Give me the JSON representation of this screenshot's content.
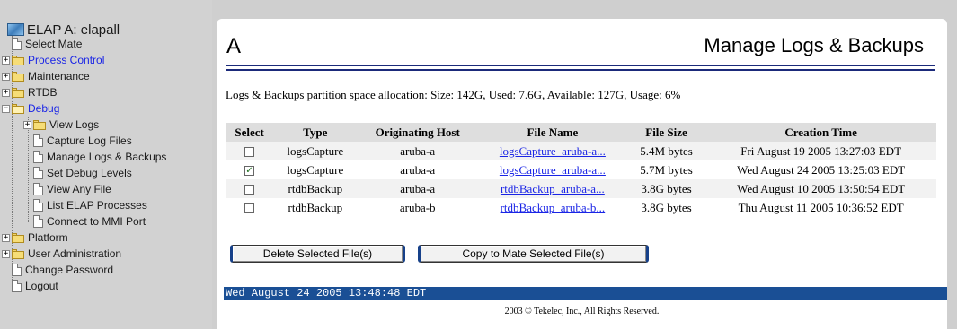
{
  "tree": {
    "root_label": "ELAP A: elapall",
    "items": [
      {
        "label": "Select Mate",
        "kind": "page",
        "level": 0
      },
      {
        "label": "Process Control",
        "kind": "folder",
        "level": 0,
        "link": true,
        "expander": "+"
      },
      {
        "label": "Maintenance",
        "kind": "folder",
        "level": 0,
        "expander": "+"
      },
      {
        "label": "RTDB",
        "kind": "folder",
        "level": 0,
        "expander": "+"
      },
      {
        "label": "Debug",
        "kind": "folder-open",
        "level": 0,
        "link": true,
        "expander": "−"
      },
      {
        "label": "View Logs",
        "kind": "folder",
        "level": 1,
        "expander": "+"
      },
      {
        "label": "Capture Log Files",
        "kind": "page",
        "level": 1
      },
      {
        "label": "Manage Logs & Backups",
        "kind": "page",
        "level": 1
      },
      {
        "label": "Set Debug Levels",
        "kind": "page",
        "level": 1
      },
      {
        "label": "View Any File",
        "kind": "page",
        "level": 1
      },
      {
        "label": "List ELAP Processes",
        "kind": "page",
        "level": 1
      },
      {
        "label": "Connect to MMI Port",
        "kind": "page",
        "level": 1
      },
      {
        "label": "Platform",
        "kind": "folder",
        "level": 0,
        "expander": "+"
      },
      {
        "label": "User Administration",
        "kind": "folder",
        "level": 0,
        "expander": "+"
      },
      {
        "label": "Change Password",
        "kind": "page",
        "level": 0
      },
      {
        "label": "Logout",
        "kind": "page",
        "level": 0
      }
    ]
  },
  "main": {
    "title_left": "A",
    "title": "Manage Logs & Backups",
    "partition_info": "Logs & Backups partition space allocation: Size: 142G, Used: 7.6G, Available: 127G, Usage: 6%",
    "table": {
      "headers": [
        "Select",
        "Type",
        "Originating Host",
        "File Name",
        "File Size",
        "Creation Time"
      ],
      "rows": [
        {
          "checked": false,
          "type": "logsCapture",
          "host": "aruba-a",
          "file": "logsCapture_aruba-a...",
          "size": "5.4M bytes",
          "time": "Fri August 19 2005 13:27:03 EDT"
        },
        {
          "checked": true,
          "type": "logsCapture",
          "host": "aruba-a",
          "file": "logsCapture_aruba-a...",
          "size": "5.7M bytes",
          "time": "Wed August 24 2005 13:25:03 EDT"
        },
        {
          "checked": false,
          "type": "rtdbBackup",
          "host": "aruba-a",
          "file": "rtdbBackup_aruba-a...",
          "size": "3.8G bytes",
          "time": "Wed August 10 2005 13:50:54 EDT"
        },
        {
          "checked": false,
          "type": "rtdbBackup",
          "host": "aruba-b",
          "file": "rtdbBackup_aruba-b...",
          "size": "3.8G bytes",
          "time": "Thu August 11 2005 10:36:52 EDT"
        }
      ]
    },
    "buttons": {
      "delete": "Delete Selected File(s)",
      "copy": "Copy to Mate Selected File(s)"
    },
    "status_time": "Wed August 24 2005 13:48:48 EDT",
    "copyright": "2003 © Tekelec, Inc., All Rights Reserved."
  },
  "colors": {
    "link": "#1a25e6",
    "status_bar": "#1a4f95",
    "title_rule": "#1b2a7a",
    "sidebar_bg": "#d2d2d2"
  }
}
